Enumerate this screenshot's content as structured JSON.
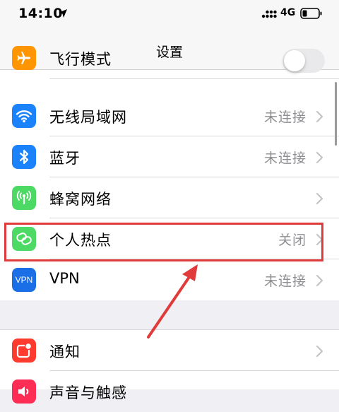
{
  "status_bar": {
    "time": "14:10",
    "network": "4G"
  },
  "nav": {
    "title": "设置"
  },
  "settings": {
    "airplane": {
      "label": "飞行模式",
      "icon": "airplane-icon",
      "color": "#ff9500",
      "toggle_on": false
    },
    "wifi": {
      "label": "无线局域网",
      "value": "未连接",
      "icon": "wifi-icon",
      "color": "#1a82fb"
    },
    "bluetooth": {
      "label": "蓝牙",
      "value": "未连接",
      "icon": "bluetooth-icon",
      "color": "#1a82fb"
    },
    "cellular": {
      "label": "蜂窝网络",
      "icon": "cellular-antenna-icon",
      "color": "#4cd964"
    },
    "hotspot": {
      "label": "个人热点",
      "value": "关闭",
      "icon": "hotspot-link-icon",
      "color": "#4cd964"
    },
    "vpn": {
      "label": "VPN",
      "value": "未连接",
      "icon_text": "VPN",
      "icon": "vpn-icon",
      "color": "#1a6ee6"
    },
    "notifications": {
      "label": "通知",
      "icon": "notifications-icon",
      "color": "#ff3b30"
    },
    "sounds": {
      "label": "声音与触感",
      "icon": "sounds-icon",
      "color": "#ff2d55"
    }
  },
  "annotation": {
    "highlight_color": "#e03a3a",
    "arrow_color": "#e03a3a"
  }
}
